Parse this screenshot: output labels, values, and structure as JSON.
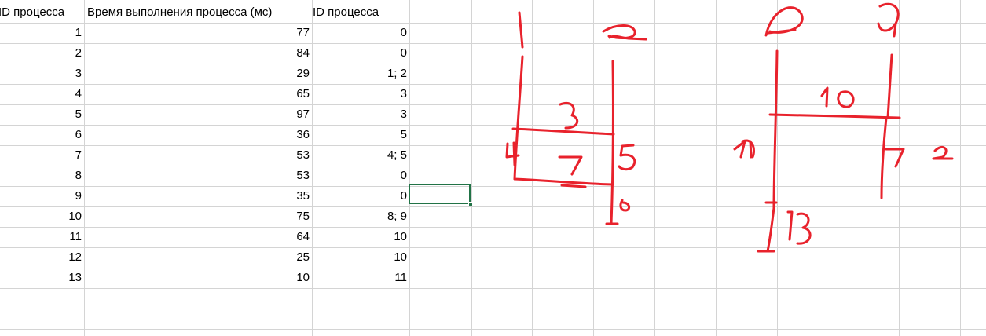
{
  "sheet": {
    "headers": [
      "ID процесса",
      "Время выполнения процесса (мс)",
      "ID процесса"
    ],
    "rows": [
      [
        "1",
        "77",
        "0"
      ],
      [
        "2",
        "84",
        "0"
      ],
      [
        "3",
        "29",
        "1; 2"
      ],
      [
        "4",
        "65",
        "3"
      ],
      [
        "5",
        "97",
        "3"
      ],
      [
        "6",
        "36",
        "5"
      ],
      [
        "7",
        "53",
        "4; 5"
      ],
      [
        "8",
        "53",
        "0"
      ],
      [
        "9",
        "35",
        "0"
      ],
      [
        "10",
        "75",
        "8; 9"
      ],
      [
        "11",
        "64",
        "10"
      ],
      [
        "12",
        "25",
        "10"
      ],
      [
        "13",
        "10",
        "11"
      ]
    ]
  },
  "colors": {
    "gridline": "#d4d4d4",
    "selection": "#217346",
    "ink": "#e8222c"
  }
}
